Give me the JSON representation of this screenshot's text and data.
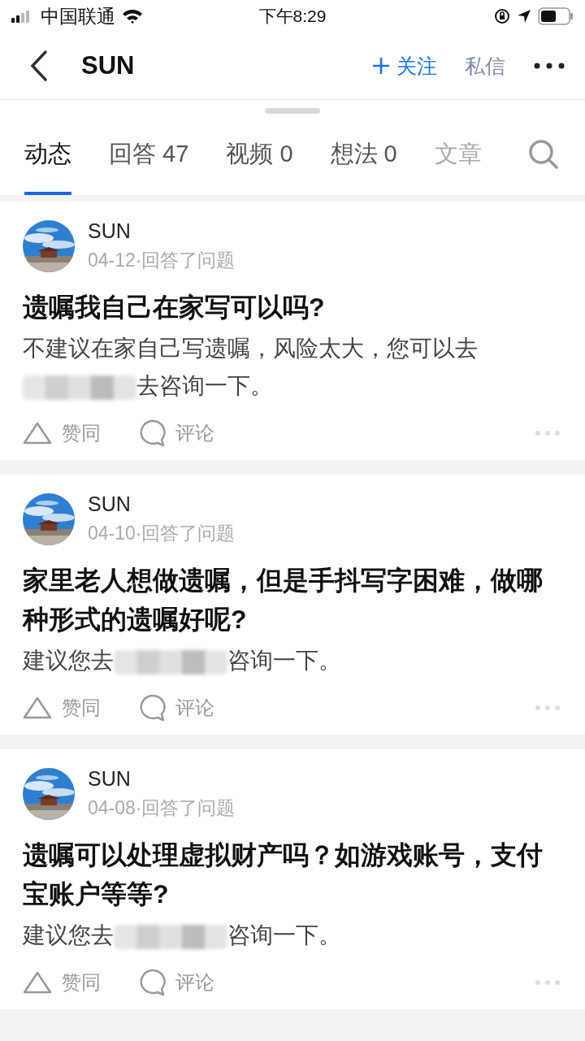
{
  "status_bar": {
    "carrier": "中国联通",
    "time": "下午8:29"
  },
  "nav": {
    "title": "SUN",
    "follow": "关注",
    "message": "私信"
  },
  "tabs": [
    {
      "label": "动态",
      "selected": true
    },
    {
      "label": "回答 47",
      "selected": false
    },
    {
      "label": "视频 0",
      "selected": false
    },
    {
      "label": "想法 0",
      "selected": false
    },
    {
      "label": "文章",
      "selected": false
    }
  ],
  "posts": [
    {
      "author": "SUN",
      "meta": "04-12·回答了问题",
      "title": "遗嘱我自己在家写可以吗?",
      "answer_parts": [
        {
          "kind": "text",
          "text": "不建议在家自己写遗嘱，风险太大，您可以去"
        },
        {
          "kind": "redacted"
        },
        {
          "kind": "text",
          "text": "去咨询一下。"
        }
      ],
      "like": "赞同",
      "comment": "评论"
    },
    {
      "author": "SUN",
      "meta": "04-10·回答了问题",
      "title": "家里老人想做遗嘱，但是手抖写字困难，做哪种形式的遗嘱好呢?",
      "answer_parts": [
        {
          "kind": "text",
          "text": "建议您去"
        },
        {
          "kind": "redacted"
        },
        {
          "kind": "text",
          "text": "咨询一下。"
        }
      ],
      "like": "赞同",
      "comment": "评论"
    },
    {
      "author": "SUN",
      "meta": "04-08·回答了问题",
      "title": "遗嘱可以处理虚拟财产吗？如游戏账号，支付宝账户等等?",
      "answer_parts": [
        {
          "kind": "text",
          "text": "建议您去"
        },
        {
          "kind": "redacted"
        },
        {
          "kind": "text",
          "text": "咨询一下。"
        }
      ],
      "like": "赞同",
      "comment": "评论"
    }
  ]
}
